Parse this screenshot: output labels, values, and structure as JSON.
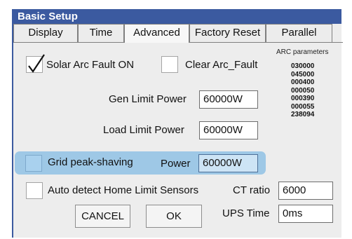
{
  "window": {
    "title": "Basic Setup"
  },
  "tabs": [
    {
      "label": "Display"
    },
    {
      "label": "Time"
    },
    {
      "label": "Advanced"
    },
    {
      "label": "Factory Reset"
    },
    {
      "label": "Parallel"
    }
  ],
  "active_tab": "Advanced",
  "solar_arc_fault": {
    "label": "Solar Arc Fault ON",
    "checked": true
  },
  "clear_arc_fault": {
    "label": "Clear Arc_Fault",
    "checked": false
  },
  "arc_parameters": {
    "title": "ARC parameters",
    "values": [
      "030000",
      "045000",
      "000400",
      "000050",
      "000390",
      "000055",
      "238094"
    ]
  },
  "gen_limit_power": {
    "label": "Gen Limit Power",
    "value": "60000W"
  },
  "load_limit_power": {
    "label": "Load Limit Power",
    "value": "60000W"
  },
  "grid_peak_shaving": {
    "label": "Grid peak-shaving",
    "checked": false,
    "power_label": "Power",
    "power_value": "60000W",
    "highlight_color": "#9ec8e6"
  },
  "auto_detect": {
    "label": "Auto detect Home Limit Sensors",
    "checked": false
  },
  "ct_ratio": {
    "label": "CT ratio",
    "value": "6000"
  },
  "ups_time": {
    "label": "UPS Time",
    "value": "0ms"
  },
  "buttons": {
    "cancel": "CANCEL",
    "ok": "OK"
  },
  "colors": {
    "titlebar": "#3b5aa0",
    "background": "#ededed"
  }
}
